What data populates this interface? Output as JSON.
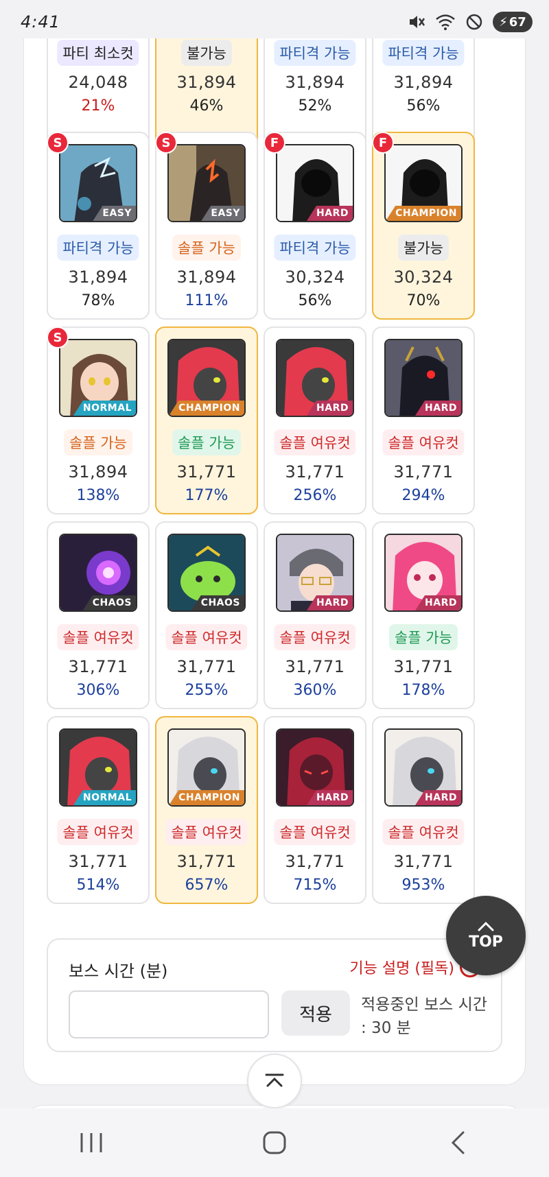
{
  "status": {
    "time": "4:41",
    "battery": "67"
  },
  "tiles": [
    {
      "tag": "파티 최소컷",
      "tag_style": "party-min",
      "score": "24,048",
      "pct": "21%",
      "pct_color": "red",
      "hl": false,
      "partial_top": true,
      "badge": ""
    },
    {
      "tag": "불가능",
      "tag_style": "none",
      "score": "31,894",
      "pct": "46%",
      "pct_color": "black",
      "hl": true,
      "partial_top": true,
      "badge": ""
    },
    {
      "tag": "파티격 가능",
      "tag_style": "partial",
      "score": "31,894",
      "pct": "52%",
      "pct_color": "black",
      "hl": false,
      "partial_top": true,
      "badge": ""
    },
    {
      "tag": "파티격 가능",
      "tag_style": "partial",
      "score": "31,894",
      "pct": "56%",
      "pct_color": "black",
      "hl": false,
      "partial_top": true,
      "badge": ""
    },
    {
      "tag": "파티격 가능",
      "tag_style": "partial",
      "score": "31,894",
      "pct": "78%",
      "pct_color": "black",
      "hl": false,
      "badge": "S",
      "difficulty": "EASY",
      "diff_color": "#6c6c72",
      "portrait": "dark-knight-blue"
    },
    {
      "tag": "솔플 가능",
      "tag_style": "solo-able",
      "score": "31,894",
      "pct": "111%",
      "pct_color": "blue",
      "hl": false,
      "badge": "S",
      "difficulty": "EASY",
      "diff_color": "#6c6c72",
      "portrait": "fire-demon"
    },
    {
      "tag": "파티격 가능",
      "tag_style": "partial",
      "score": "30,324",
      "pct": "56%",
      "pct_color": "black",
      "hl": false,
      "badge": "F",
      "difficulty": "HARD",
      "diff_color": "#b8345a",
      "portrait": "hooded"
    },
    {
      "tag": "불가능",
      "tag_style": "none",
      "score": "30,324",
      "pct": "70%",
      "pct_color": "black",
      "hl": true,
      "badge": "F",
      "difficulty": "CHAMPION",
      "diff_color": "#d9822b",
      "portrait": "hooded"
    },
    {
      "tag": "솔플 가능",
      "tag_style": "solo-able",
      "score": "31,894",
      "pct": "138%",
      "pct_color": "blue",
      "hl": false,
      "badge": "S",
      "difficulty": "NORMAL",
      "diff_color": "#25a4c1",
      "portrait": "brown-hair"
    },
    {
      "tag": "솔플 가능",
      "tag_style": "solo-able-green",
      "score": "31,771",
      "pct": "177%",
      "pct_color": "blue",
      "hl": true,
      "badge": "",
      "difficulty": "CHAMPION",
      "diff_color": "#d9822b",
      "portrait": "red-hair"
    },
    {
      "tag": "솔플 여유컷",
      "tag_style": "solo-margin",
      "score": "31,771",
      "pct": "256%",
      "pct_color": "blue",
      "hl": false,
      "badge": "",
      "difficulty": "HARD",
      "diff_color": "#b8345a",
      "portrait": "red-hair"
    },
    {
      "tag": "솔플 여유컷",
      "tag_style": "solo-margin",
      "score": "31,771",
      "pct": "294%",
      "pct_color": "blue",
      "hl": false,
      "badge": "",
      "difficulty": "HARD",
      "diff_color": "#b8345a",
      "portrait": "dark-armor"
    },
    {
      "tag": "솔플 여유컷",
      "tag_style": "solo-margin",
      "score": "31,771",
      "pct": "306%",
      "pct_color": "blue",
      "hl": false,
      "badge": "",
      "difficulty": "CHAOS",
      "diff_color": "#3a3a3a",
      "portrait": "purple-orb"
    },
    {
      "tag": "솔플 여유컷",
      "tag_style": "solo-margin",
      "score": "31,771",
      "pct": "255%",
      "pct_color": "blue",
      "hl": false,
      "badge": "",
      "difficulty": "CHAOS",
      "diff_color": "#3a3a3a",
      "portrait": "green-slime"
    },
    {
      "tag": "솔플 여유컷",
      "tag_style": "solo-margin",
      "score": "31,771",
      "pct": "360%",
      "pct_color": "blue",
      "hl": false,
      "badge": "",
      "difficulty": "HARD",
      "diff_color": "#b8345a",
      "portrait": "glasses"
    },
    {
      "tag": "솔플 가능",
      "tag_style": "solo-able-green",
      "score": "31,771",
      "pct": "178%",
      "pct_color": "blue",
      "hl": false,
      "badge": "",
      "difficulty": "HARD",
      "diff_color": "#b8345a",
      "portrait": "pink-hair"
    },
    {
      "tag": "솔플 여유컷",
      "tag_style": "solo-margin",
      "score": "31,771",
      "pct": "514%",
      "pct_color": "blue",
      "hl": false,
      "badge": "",
      "difficulty": "NORMAL",
      "diff_color": "#25a4c1",
      "portrait": "red-hair"
    },
    {
      "tag": "솔플 여유컷",
      "tag_style": "solo-margin",
      "score": "31,771",
      "pct": "657%",
      "pct_color": "blue",
      "hl": true,
      "badge": "",
      "difficulty": "CHAMPION",
      "diff_color": "#d9822b",
      "portrait": "silver-hair"
    },
    {
      "tag": "솔플 여유컷",
      "tag_style": "solo-margin",
      "score": "31,771",
      "pct": "715%",
      "pct_color": "blue",
      "hl": false,
      "badge": "",
      "difficulty": "HARD",
      "diff_color": "#b8345a",
      "portrait": "crimson"
    },
    {
      "tag": "솔플 여유컷",
      "tag_style": "solo-margin",
      "score": "31,771",
      "pct": "953%",
      "pct_color": "blue",
      "hl": false,
      "badge": "",
      "difficulty": "HARD",
      "diff_color": "#b8345a",
      "portrait": "silver-hair"
    }
  ],
  "boss_time": {
    "label": "보스 시간 (분)",
    "help_label": "기능 설명 (필독)",
    "help_icon": "?",
    "input_value": "",
    "apply_label": "적용",
    "current": "적용중인 보스 시간 : 30 분"
  },
  "top_button": {
    "label": "TOP"
  },
  "colors": {
    "highlight_bg": "#fef5dc",
    "highlight_border": "#f0b63e",
    "badge_red": "#e8283a"
  }
}
